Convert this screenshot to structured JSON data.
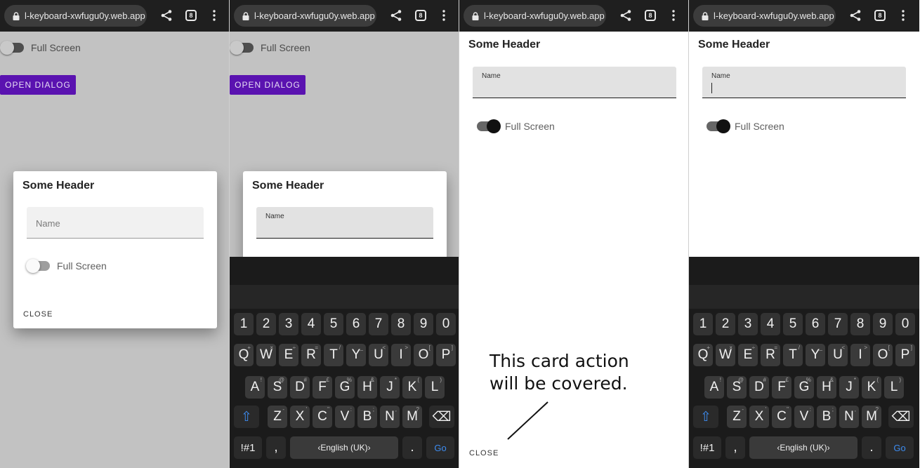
{
  "browser": {
    "url": "l-keyboard-xwfugu0y.web.app",
    "tab_count": "8"
  },
  "page": {
    "toggle_label": "Full Screen",
    "open_dialog_label": "OPEN DIALOG"
  },
  "dialog": {
    "header": "Some Header",
    "name_label": "Name",
    "toggle_label": "Full Screen",
    "close_label": "CLOSE"
  },
  "annotation": {
    "line1": "This card action",
    "line2": "will be covered."
  },
  "keyboard": {
    "number_row": [
      "1",
      "2",
      "3",
      "4",
      "5",
      "6",
      "7",
      "8",
      "9",
      "0"
    ],
    "row1": [
      {
        "key": "Q",
        "sup": "+"
      },
      {
        "key": "W",
        "sup": "×"
      },
      {
        "key": "E",
        "sup": "÷"
      },
      {
        "key": "R",
        "sup": "="
      },
      {
        "key": "T",
        "sup": "/"
      },
      {
        "key": "Y",
        "sup": "_"
      },
      {
        "key": "U",
        "sup": "<"
      },
      {
        "key": "I",
        "sup": ">"
      },
      {
        "key": "O",
        "sup": "["
      },
      {
        "key": "P",
        "sup": "]"
      }
    ],
    "row2": [
      {
        "key": "A",
        "sup": "!"
      },
      {
        "key": "S",
        "sup": "@"
      },
      {
        "key": "D",
        "sup": "#"
      },
      {
        "key": "F",
        "sup": "£"
      },
      {
        "key": "G",
        "sup": "%"
      },
      {
        "key": "H",
        "sup": "&"
      },
      {
        "key": "J",
        "sup": "*"
      },
      {
        "key": "K",
        "sup": "("
      },
      {
        "key": "L",
        "sup": ")"
      }
    ],
    "row3": [
      {
        "key": "Z",
        "sup": "-"
      },
      {
        "key": "X",
        "sup": "'"
      },
      {
        "key": "C",
        "sup": "\""
      },
      {
        "key": "V",
        "sup": ":"
      },
      {
        "key": "B",
        "sup": ";"
      },
      {
        "key": "N",
        "sup": ","
      },
      {
        "key": "M",
        "sup": "?"
      }
    ],
    "symbols_label": "!#1",
    "comma_label": ",",
    "language_label": "English (UK)",
    "period_label": ".",
    "go_label": "Go",
    "more_label": "···"
  },
  "colors": {
    "primary_button": "#5a12b0",
    "scrim": "#c2c2c2",
    "keyboard_bg": "#1b1b1b",
    "accent_key": "#3d8cf0"
  }
}
